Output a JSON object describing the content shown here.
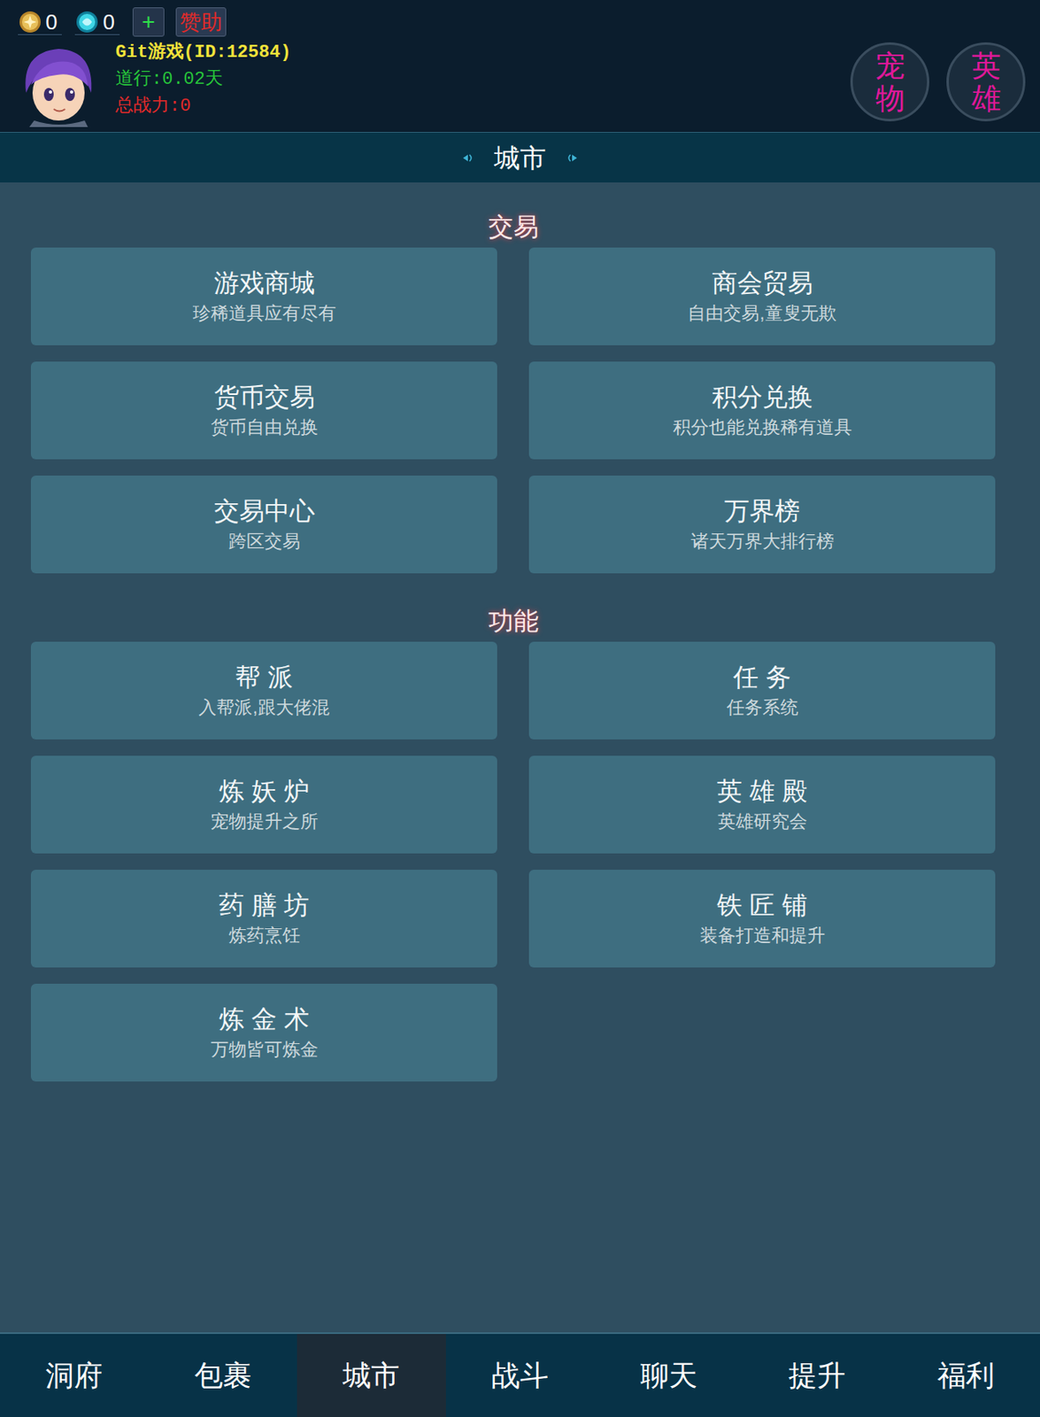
{
  "currencies": [
    {
      "kind": "gold",
      "value": "0"
    },
    {
      "kind": "gem",
      "value": "0"
    }
  ],
  "add_button": "+",
  "sponsor_button": "赞助",
  "player": {
    "name": "Git游戏(ID:12584)",
    "daohang": "道行:0.02天",
    "power": "总战力:0"
  },
  "quick_buttons": [
    "宠物",
    "英雄"
  ],
  "page_title": "城市",
  "sections": [
    {
      "title": "交易",
      "items": [
        {
          "title": "游戏商城",
          "subtitle": "珍稀道具应有尽有"
        },
        {
          "title": "商会贸易",
          "subtitle": "自由交易,童叟无欺"
        },
        {
          "title": "货币交易",
          "subtitle": "货币自由兑换"
        },
        {
          "title": "积分兑换",
          "subtitle": "积分也能兑换稀有道具"
        },
        {
          "title": "交易中心",
          "subtitle": "跨区交易"
        },
        {
          "title": "万界榜",
          "subtitle": "诸天万界大排行榜"
        }
      ]
    },
    {
      "title": "功能",
      "items": [
        {
          "title": "帮 派",
          "subtitle": "入帮派,跟大佬混"
        },
        {
          "title": "任 务",
          "subtitle": "任务系统"
        },
        {
          "title": "炼 妖 炉",
          "subtitle": "宠物提升之所"
        },
        {
          "title": "英 雄 殿",
          "subtitle": "英雄研究会"
        },
        {
          "title": "药 膳 坊",
          "subtitle": "炼药烹饪"
        },
        {
          "title": "铁 匠 铺",
          "subtitle": "装备打造和提升"
        },
        {
          "title": "炼 金 术",
          "subtitle": "万物皆可炼金"
        }
      ]
    }
  ],
  "nav": [
    {
      "label": "洞府",
      "selected": false
    },
    {
      "label": "包裹",
      "selected": false
    },
    {
      "label": "城市",
      "selected": true
    },
    {
      "label": "战斗",
      "selected": false
    },
    {
      "label": "聊天",
      "selected": false
    },
    {
      "label": "提升",
      "selected": false
    },
    {
      "label": "福利",
      "selected": false
    }
  ]
}
